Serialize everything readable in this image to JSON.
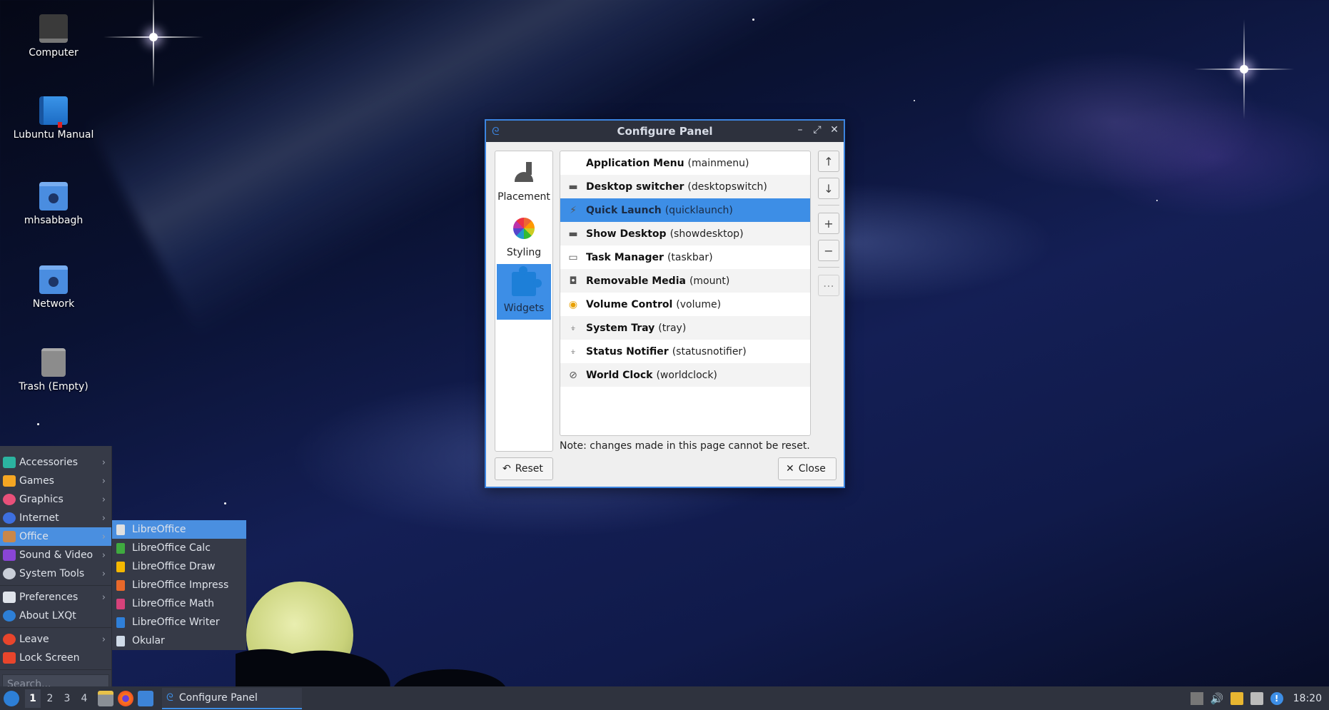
{
  "desktop": {
    "icons": [
      {
        "label": "Computer",
        "icon": "computer-icon"
      },
      {
        "label": "Lubuntu Manual",
        "icon": "manual-book-icon"
      },
      {
        "label": "mhsabbagh",
        "icon": "home-folder-icon"
      },
      {
        "label": "Network",
        "icon": "network-folder-icon"
      },
      {
        "label": "Trash (Empty)",
        "icon": "trash-icon"
      }
    ]
  },
  "dialog": {
    "title": "Configure Panel",
    "window_buttons": {
      "minimize": "–",
      "maximize": "⤢",
      "close": "✕"
    },
    "sidebar": [
      {
        "label": "Placement",
        "icon": "wrench-icon",
        "active": false
      },
      {
        "label": "Styling",
        "icon": "color-wheel-icon",
        "active": false
      },
      {
        "label": "Widgets",
        "icon": "puzzle-icon",
        "active": true
      }
    ],
    "widgets": [
      {
        "name": "Application Menu",
        "id": "(mainmenu)",
        "icon": "",
        "selected": false
      },
      {
        "name": "Desktop switcher",
        "id": "(desktopswitch)",
        "icon": "▬",
        "selected": false
      },
      {
        "name": "Quick Launch",
        "id": "(quicklaunch)",
        "icon": "⚡",
        "selected": true
      },
      {
        "name": "Show Desktop",
        "id": "(showdesktop)",
        "icon": "▬",
        "selected": false
      },
      {
        "name": "Task Manager",
        "id": "(taskbar)",
        "icon": "▭",
        "selected": false
      },
      {
        "name": "Removable Media",
        "id": "(mount)",
        "icon": "◘",
        "selected": false
      },
      {
        "name": "Volume Control",
        "id": "(volume)",
        "icon": "◉",
        "selected": false
      },
      {
        "name": "System Tray",
        "id": "(tray)",
        "icon": "⍖",
        "selected": false
      },
      {
        "name": "Status Notifier",
        "id": "(statusnotifier)",
        "icon": "⍖",
        "selected": false
      },
      {
        "name": "World Clock",
        "id": "(worldclock)",
        "icon": "⊘",
        "selected": false
      }
    ],
    "side_buttons": {
      "move_up": "↑",
      "move_down": "↓",
      "add": "+",
      "remove": "−",
      "configure": "⋯"
    },
    "note": "Note: changes made in this page cannot be reset.",
    "reset_label": "Reset",
    "reset_icon": "↶",
    "close_label": "Close",
    "close_icon": "✕"
  },
  "menu": {
    "items": [
      {
        "label": "Accessories",
        "submenu": true,
        "color": "#2bb3a0"
      },
      {
        "label": "Games",
        "submenu": true,
        "color": "#f5a623"
      },
      {
        "label": "Graphics",
        "submenu": true,
        "color": "#e8507a"
      },
      {
        "label": "Internet",
        "submenu": true,
        "color": "#3d6fe0"
      },
      {
        "label": "Office",
        "submenu": true,
        "color": "#c8874a",
        "highlighted": true
      },
      {
        "label": "Sound & Video",
        "submenu": true,
        "color": "#8a45d6"
      },
      {
        "label": "System Tools",
        "submenu": true,
        "color": "#c9ced8"
      },
      {
        "label": "Preferences",
        "submenu": true,
        "color": "#dfe3ea"
      },
      {
        "label": "About LXQt",
        "submenu": false,
        "color": "#2d7fd6"
      },
      {
        "label": "Leave",
        "submenu": true,
        "color": "#e8452c"
      },
      {
        "label": "Lock Screen",
        "submenu": false,
        "color": "#e8452c"
      }
    ],
    "search_placeholder": "Search..."
  },
  "submenu": {
    "items": [
      {
        "label": "LibreOffice",
        "color": "#e0e0e0",
        "highlighted": true
      },
      {
        "label": "LibreOffice Calc",
        "color": "#3faa3f"
      },
      {
        "label": "LibreOffice Draw",
        "color": "#f5b800"
      },
      {
        "label": "LibreOffice Impress",
        "color": "#e8682a"
      },
      {
        "label": "LibreOffice Math",
        "color": "#d6427a"
      },
      {
        "label": "LibreOffice Writer",
        "color": "#2f7fd8"
      },
      {
        "label": "Okular",
        "color": "#d0dbe8"
      }
    ]
  },
  "taskbar": {
    "desktops": [
      "1",
      "2",
      "3",
      "4"
    ],
    "active_desktop": "1",
    "task_label": "Configure Panel",
    "clock": "18:20",
    "volume_icon": "🔊",
    "notifier_icon": "!"
  }
}
